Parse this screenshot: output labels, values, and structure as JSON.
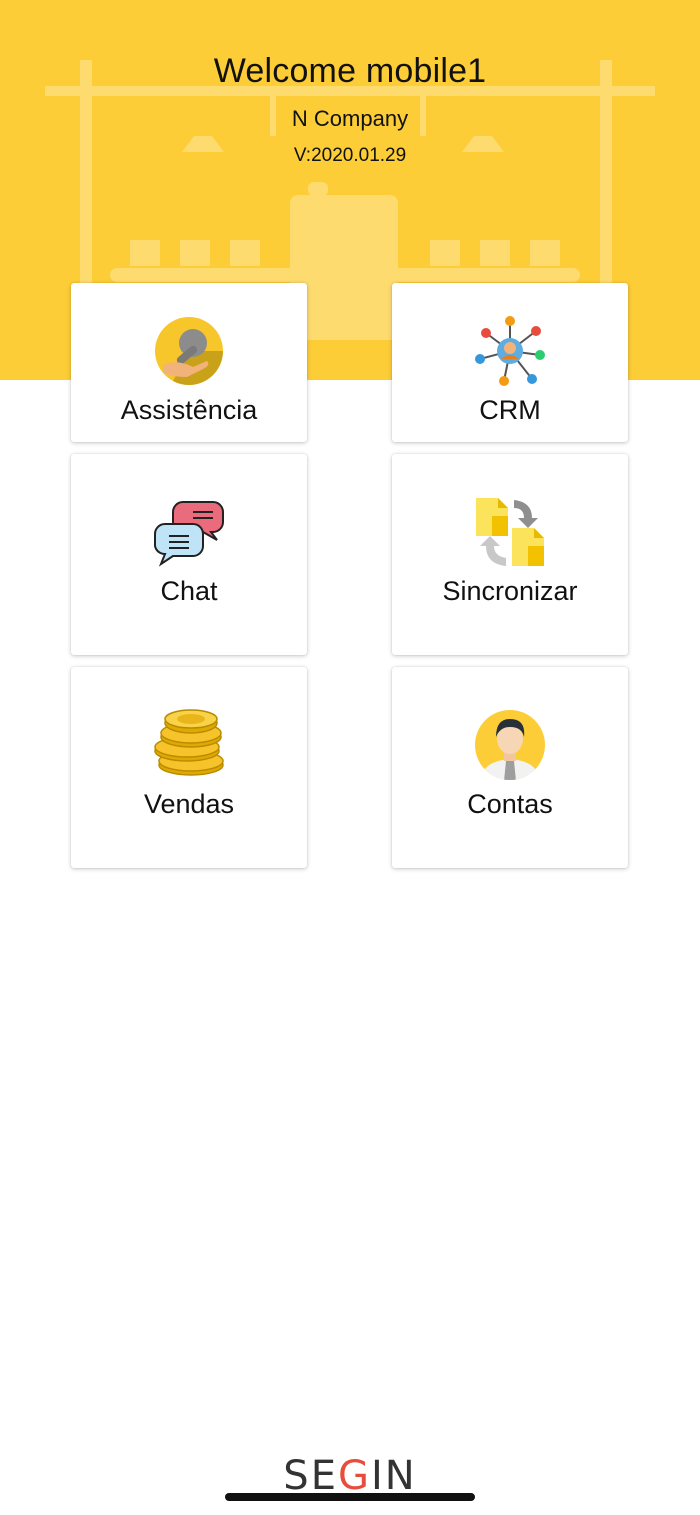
{
  "header": {
    "welcome": "Welcome mobile1",
    "company": "N Company",
    "version": "V:2020.01.29",
    "bg_color": "#fdcd37"
  },
  "menu": [
    {
      "id": "assistencia",
      "label": "Assistência",
      "icon": "wrench-hand-icon"
    },
    {
      "id": "crm",
      "label": "CRM",
      "icon": "network-people-icon"
    },
    {
      "id": "chat",
      "label": "Chat",
      "icon": "chat-bubbles-icon"
    },
    {
      "id": "sincronizar",
      "label": "Sincronizar",
      "icon": "sync-documents-icon"
    },
    {
      "id": "vendas",
      "label": "Vendas",
      "icon": "coin-stack-icon"
    },
    {
      "id": "contas",
      "label": "Contas",
      "icon": "user-avatar-icon"
    }
  ],
  "footer": {
    "brand_prefix": "SE",
    "brand_g": "G",
    "brand_suffix": "IN"
  }
}
